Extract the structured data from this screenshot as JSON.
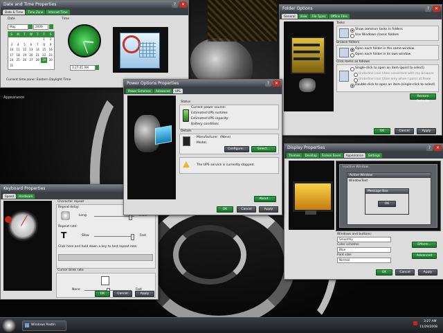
{
  "taskbar": {
    "task_label": "Windows PostIn",
    "clock_time": "3:27 AM",
    "clock_date": "11/29/2008"
  },
  "desktop": {
    "window_fragment_title": "Appearance"
  },
  "date_time": {
    "title": "Date and Time Properties",
    "tabs": [
      "Date & Time",
      "Time Zone",
      "Internet Time"
    ],
    "date_label": "Date",
    "time_label": "Time",
    "month": "May",
    "year": "2009",
    "weekdays": [
      "S",
      "M",
      "T",
      "W",
      "T",
      "F",
      "S"
    ],
    "days": [
      "",
      "",
      "",
      "",
      "",
      "1",
      "2",
      "3",
      "4",
      "5",
      "6",
      "7",
      "8",
      "9",
      "10",
      "11",
      "12",
      "13",
      "14",
      "15",
      "16",
      "17",
      "18",
      "19",
      "20",
      "21",
      "22",
      "23",
      "24",
      "25",
      "26",
      "27",
      "28",
      "29",
      "30",
      "31",
      "",
      "",
      "",
      "",
      "",
      ""
    ],
    "time_value": "3:27:41 AM",
    "timezone_text": "Current time zone: Eastern Daylight Time"
  },
  "power": {
    "title": "Power Options Properties",
    "tabs": [
      "Power Schemes",
      "Advanced",
      "UPS"
    ],
    "status_label": "Status",
    "status_rows": [
      "Current power source:",
      "Estimated UPS runtime:",
      "Estimated UPS capacity:",
      "Battery condition:"
    ],
    "details_label": "Details",
    "manufacturer_label": "Manufacturer:",
    "manufacturer_value": "(None)",
    "model_label": "Model:",
    "configure_button": "Configure...",
    "select_button": "Select...",
    "ups_message": "The UPS service is currently stopped.",
    "about_button": "About...",
    "ok": "OK",
    "cancel": "Cancel",
    "apply": "Apply"
  },
  "folder": {
    "title": "Folder Options",
    "tabs": [
      "General",
      "View",
      "File Types",
      "Offline Files"
    ],
    "tasks_label": "Tasks",
    "tasks_options": [
      "Show common tasks in folders",
      "Use Windows classic folders"
    ],
    "browse_label": "Browse folders",
    "browse_options": [
      "Open each folder in the same window",
      "Open each folder in its own window"
    ],
    "click_label": "Click items as follows",
    "click_options": [
      "Single-click to open an item (point to select)",
      "Underline icon titles consistent with my browser",
      "Underline icon titles only when I point at them",
      "Double-click to open an item (single-click to select)"
    ],
    "restore_button": "Restore Defaults",
    "ok": "OK",
    "cancel": "Cancel",
    "apply": "Apply"
  },
  "display": {
    "title": "Display Properties",
    "tabs": [
      "Themes",
      "Desktop",
      "Screen Saver",
      "Appearance",
      "Settings"
    ],
    "preview": {
      "inactive_window": "Inactive Window",
      "active_window": "Active Window",
      "menu_items": [
        "Window",
        "Text"
      ],
      "message_box": "Message Box",
      "ok": "OK"
    },
    "windows_buttons_label": "Windows and buttons:",
    "windows_buttons_value": "Smoothly",
    "color_scheme_label": "Color scheme:",
    "color_scheme_value": "Blue",
    "font_size_label": "Font size:",
    "font_size_value": "Normal",
    "effects_button": "Effects...",
    "advanced_button": "Advanced",
    "ok": "OK",
    "cancel": "Cancel",
    "apply": "Apply"
  },
  "keyboard": {
    "title": "Keyboard Properties",
    "tabs": [
      "Speed",
      "Hardware"
    ],
    "char_repeat_label": "Character repeat",
    "repeat_delay_label": "Repeat delay:",
    "long_label": "Long",
    "short_label": "Short",
    "repeat_rate_label": "Repeat rate:",
    "slow_label": "Slow",
    "fast_label": "Fast",
    "test_label": "Click here and hold down a key to test repeat rate:",
    "cursor_blink_label": "Cursor blink rate",
    "none_label": "None",
    "fast2_label": "Fast",
    "ok": "OK",
    "cancel": "Cancel",
    "apply": "Apply",
    "repeat_delay_level": 0.9,
    "repeat_rate_level": 0.95,
    "blink_level": 0.5
  },
  "colors": {
    "accent_green": "#2e8e3c",
    "title_gray": "#4a4f55",
    "close_red": "#b83228"
  }
}
